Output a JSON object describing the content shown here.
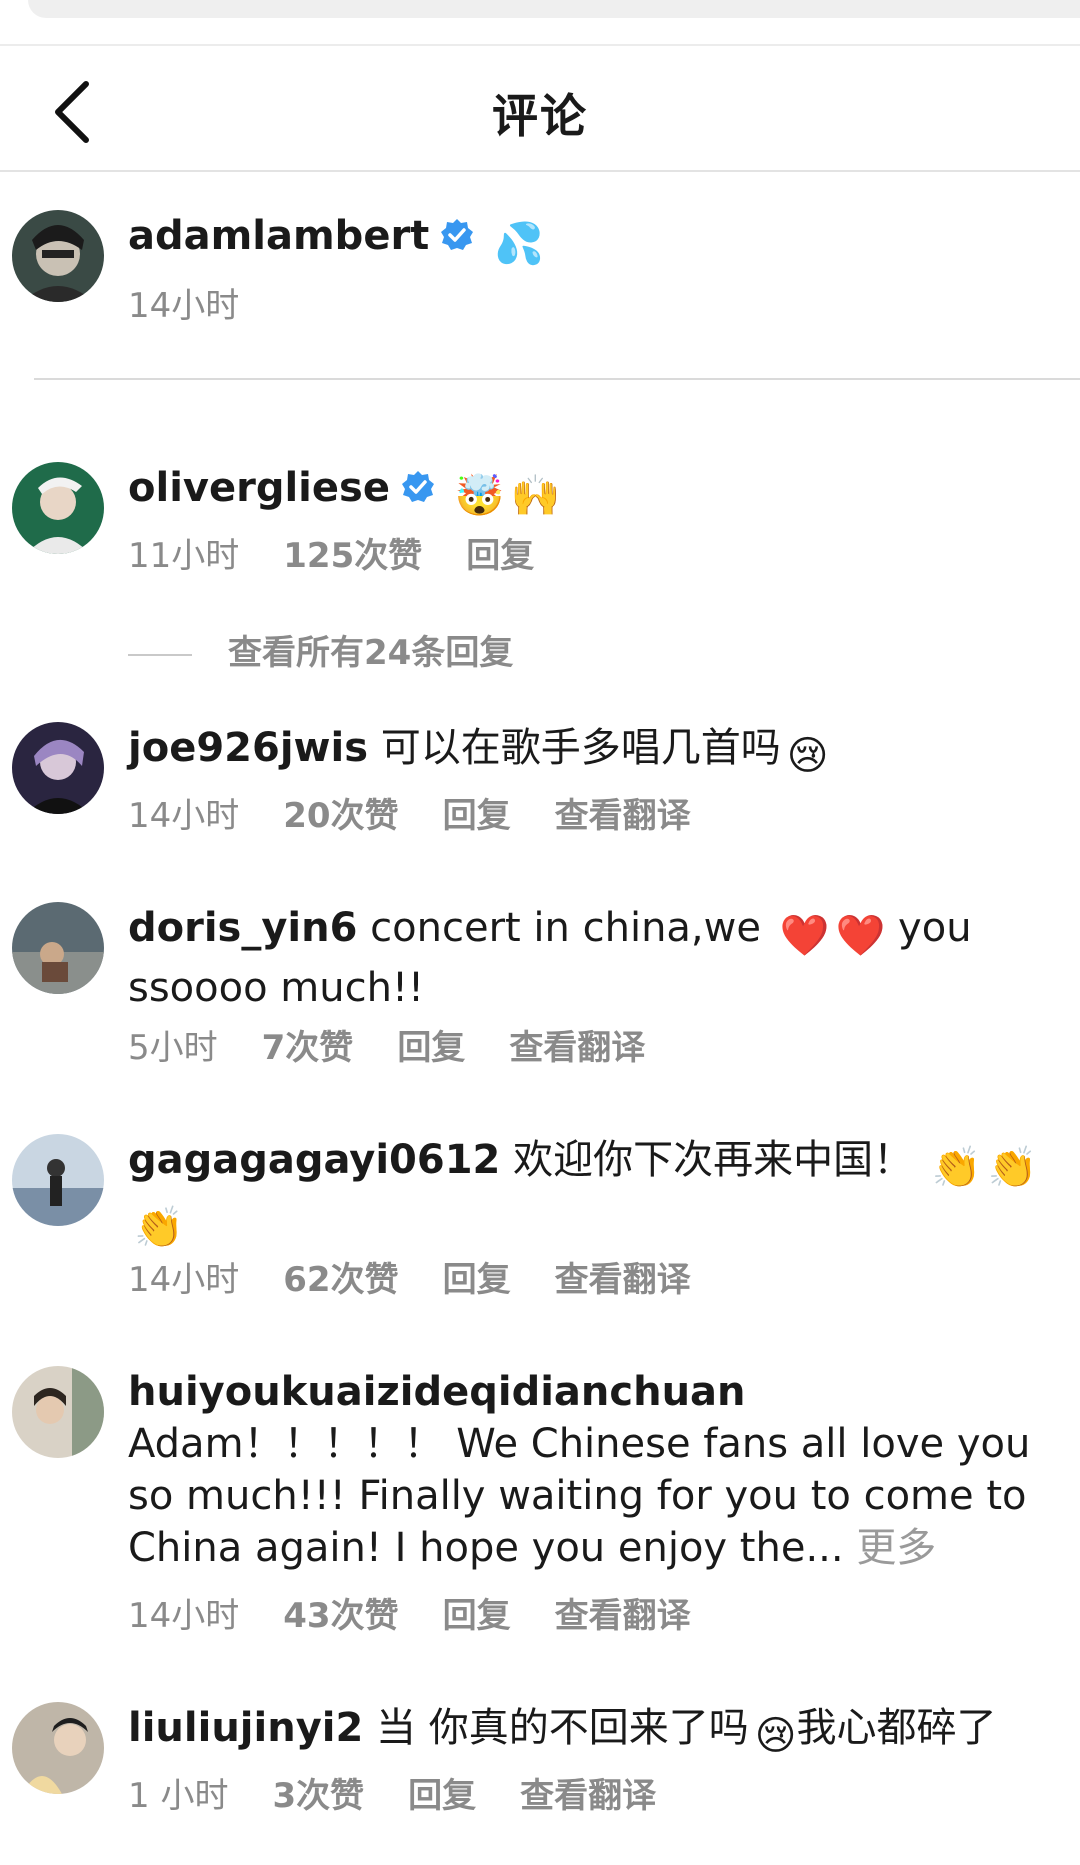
{
  "header": {
    "title": "评论"
  },
  "caption": {
    "username": "adamlambert",
    "emoji": "💦",
    "time": "14小时"
  },
  "comments": [
    {
      "username": "olivergliese",
      "text": "",
      "emojis": [
        "🤯",
        "🙌"
      ],
      "time": "11小时",
      "likes": "125次赞",
      "reply": "回复",
      "view_replies": "查看所有24条回复"
    },
    {
      "username": "joe926jwis",
      "text": "可以在歌手多唱几首吗",
      "emoji_end": "😢",
      "time": "14小时",
      "likes": "20次赞",
      "reply": "回复",
      "translate": "查看翻译"
    },
    {
      "username": "doris_yin6",
      "text_a": "concert in china,we",
      "emojis": [
        "❤️",
        "❤️"
      ],
      "text_b": "you ssoooo much!!",
      "time": "5小时",
      "likes": "7次赞",
      "reply": "回复",
      "translate": "查看翻译"
    },
    {
      "username": "gagagagayi0612",
      "text": "欢迎你下次再来中国！",
      "emojis": [
        "👏",
        "👏",
        "👏"
      ],
      "time": "14小时",
      "likes": "62次赞",
      "reply": "回复",
      "translate": "查看翻译"
    },
    {
      "username": "huiyoukuaizideqidianchuan",
      "text": "Adam！！！！！ We Chinese fans all love you so much!!! Finally waiting for you to come to China again! I hope you enjoy the...",
      "more": "更多",
      "time": "14小时",
      "likes": "43次赞",
      "reply": "回复",
      "translate": "查看翻译"
    },
    {
      "username": "liuliujinyi2",
      "text_a": "当 你真的不回来了吗",
      "emoji_mid": "😢",
      "text_b": "我心都碎了",
      "time": "1 小时",
      "likes": "3次赞",
      "reply": "回复",
      "translate": "查看翻译"
    }
  ],
  "colors": {
    "verified": "#3897f0",
    "meta": "#8a8a8a"
  },
  "icons": {
    "back": "chevron-left-icon",
    "verified": "verified-badge-icon"
  }
}
